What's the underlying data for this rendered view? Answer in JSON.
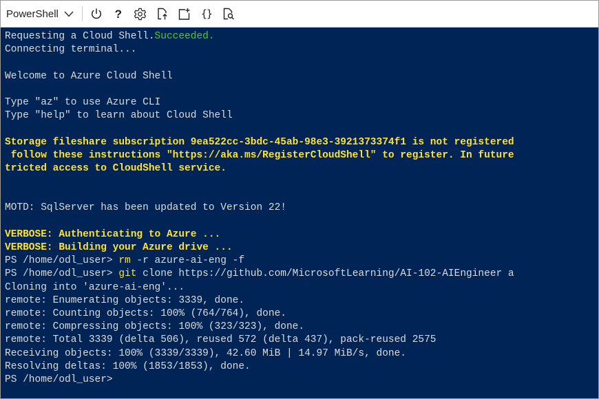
{
  "toolbar": {
    "shell_type": "PowerShell",
    "icons": [
      "chevron-down-icon",
      "power-icon",
      "help-icon",
      "gear-icon",
      "upload-download-icon",
      "new-session-icon",
      "braces-icon",
      "web-preview-icon"
    ],
    "help_glyph": "?",
    "braces_glyph": "{}"
  },
  "colors": {
    "terminal_background": "#012456",
    "text": "#dcdcdc",
    "success": "#4ec93b",
    "warning": "#ffe033"
  },
  "terminal": {
    "l1_a": "Requesting a Cloud Shell.",
    "l1_b": "Succeeded.",
    "l2": "Connecting terminal...",
    "l4": "Welcome to Azure Cloud Shell",
    "l6": "Type \"az\" to use Azure CLI",
    "l7": "Type \"help\" to learn about Cloud Shell",
    "l9": "Storage fileshare subscription 9ea522cc-3bdc-45ab-98e3-3921373374f1 is not registered",
    "l10": " follow these instructions \"https://aka.ms/RegisterCloudShell\" to register. In future",
    "l11": "tricted access to CloudShell service.",
    "l14": "MOTD: SqlServer has been updated to Version 22!",
    "l16": "VERBOSE: Authenticating to Azure ...",
    "l17": "VERBOSE: Building your Azure drive ...",
    "l18_prompt": "PS /home/odl_user> ",
    "l18_cmd": "rm",
    "l18_args": " -r azure-ai-eng -f",
    "l19_prompt": "PS /home/odl_user> ",
    "l19_cmd": "git",
    "l19_args": " clone https://github.com/MicrosoftLearning/AI-102-AIEngineer a",
    "l20": "Cloning into 'azure-ai-eng'...",
    "l21": "remote: Enumerating objects: 3339, done.",
    "l22": "remote: Counting objects: 100% (764/764), done.",
    "l23": "remote: Compressing objects: 100% (323/323), done.",
    "l24": "remote: Total 3339 (delta 506), reused 572 (delta 437), pack-reused 2575",
    "l25": "Receiving objects: 100% (3339/3339), 42.60 MiB | 14.97 MiB/s, done.",
    "l26": "Resolving deltas: 100% (1853/1853), done.",
    "l27_prompt": "PS /home/odl_user> "
  }
}
